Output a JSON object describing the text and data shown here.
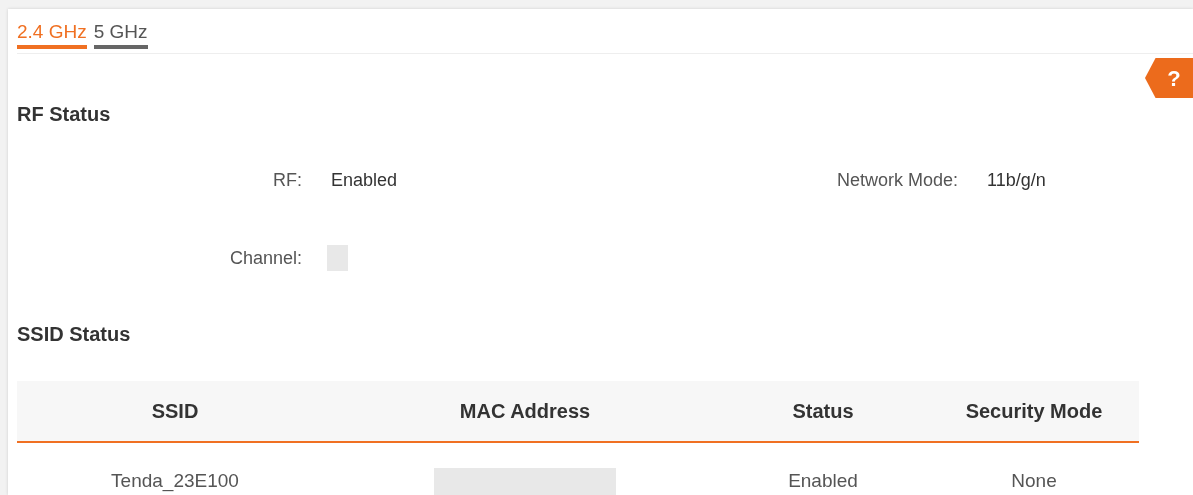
{
  "tabs": [
    {
      "label": "2.4 GHz",
      "selected": true
    },
    {
      "label": "5 GHz",
      "selected": false
    }
  ],
  "help_button": {
    "label": "?"
  },
  "rf_status": {
    "title": "RF Status",
    "fields": [
      {
        "label": "RF:",
        "value": "Enabled"
      },
      {
        "label": "Network Mode:",
        "value": "11b/g/n"
      },
      {
        "label": "Channel:",
        "kind": "redacted"
      }
    ]
  },
  "ssid_status": {
    "title": "SSID Status",
    "table": {
      "columns": [
        "SSID",
        "MAC Address",
        "Status",
        "Security Mode"
      ],
      "rows": [
        [
          {
            "text": "Tenda_23E100"
          },
          {
            "kind": "redacted"
          },
          {
            "text": "Enabled"
          },
          {
            "text": "None"
          }
        ]
      ]
    }
  }
}
